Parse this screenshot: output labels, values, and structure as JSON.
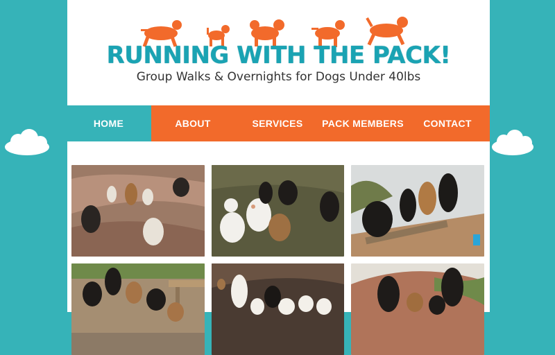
{
  "site": {
    "title": "RUNNING WITH THE PACK!",
    "tagline": "Group Walks & Overnights for Dogs Under 40lbs"
  },
  "nav": {
    "items": [
      {
        "label": "HOME"
      },
      {
        "label": "ABOUT"
      },
      {
        "label": "SERVICES"
      },
      {
        "label": "PACK MEMBERS"
      },
      {
        "label": "CONTACT"
      }
    ],
    "active_index": 0
  },
  "colors": {
    "teal": "#36b3b8",
    "orange": "#f26a2b",
    "title_teal": "#1aa3b3"
  },
  "gallery": {
    "photos": [
      {
        "subject": "dogs-on-rocks"
      },
      {
        "subject": "dogs-on-grass"
      },
      {
        "subject": "dogs-on-bench"
      },
      {
        "subject": "dogs-at-picnic-table"
      },
      {
        "subject": "dogs-in-rock-hollow"
      },
      {
        "subject": "dogs-on-trail"
      }
    ]
  }
}
